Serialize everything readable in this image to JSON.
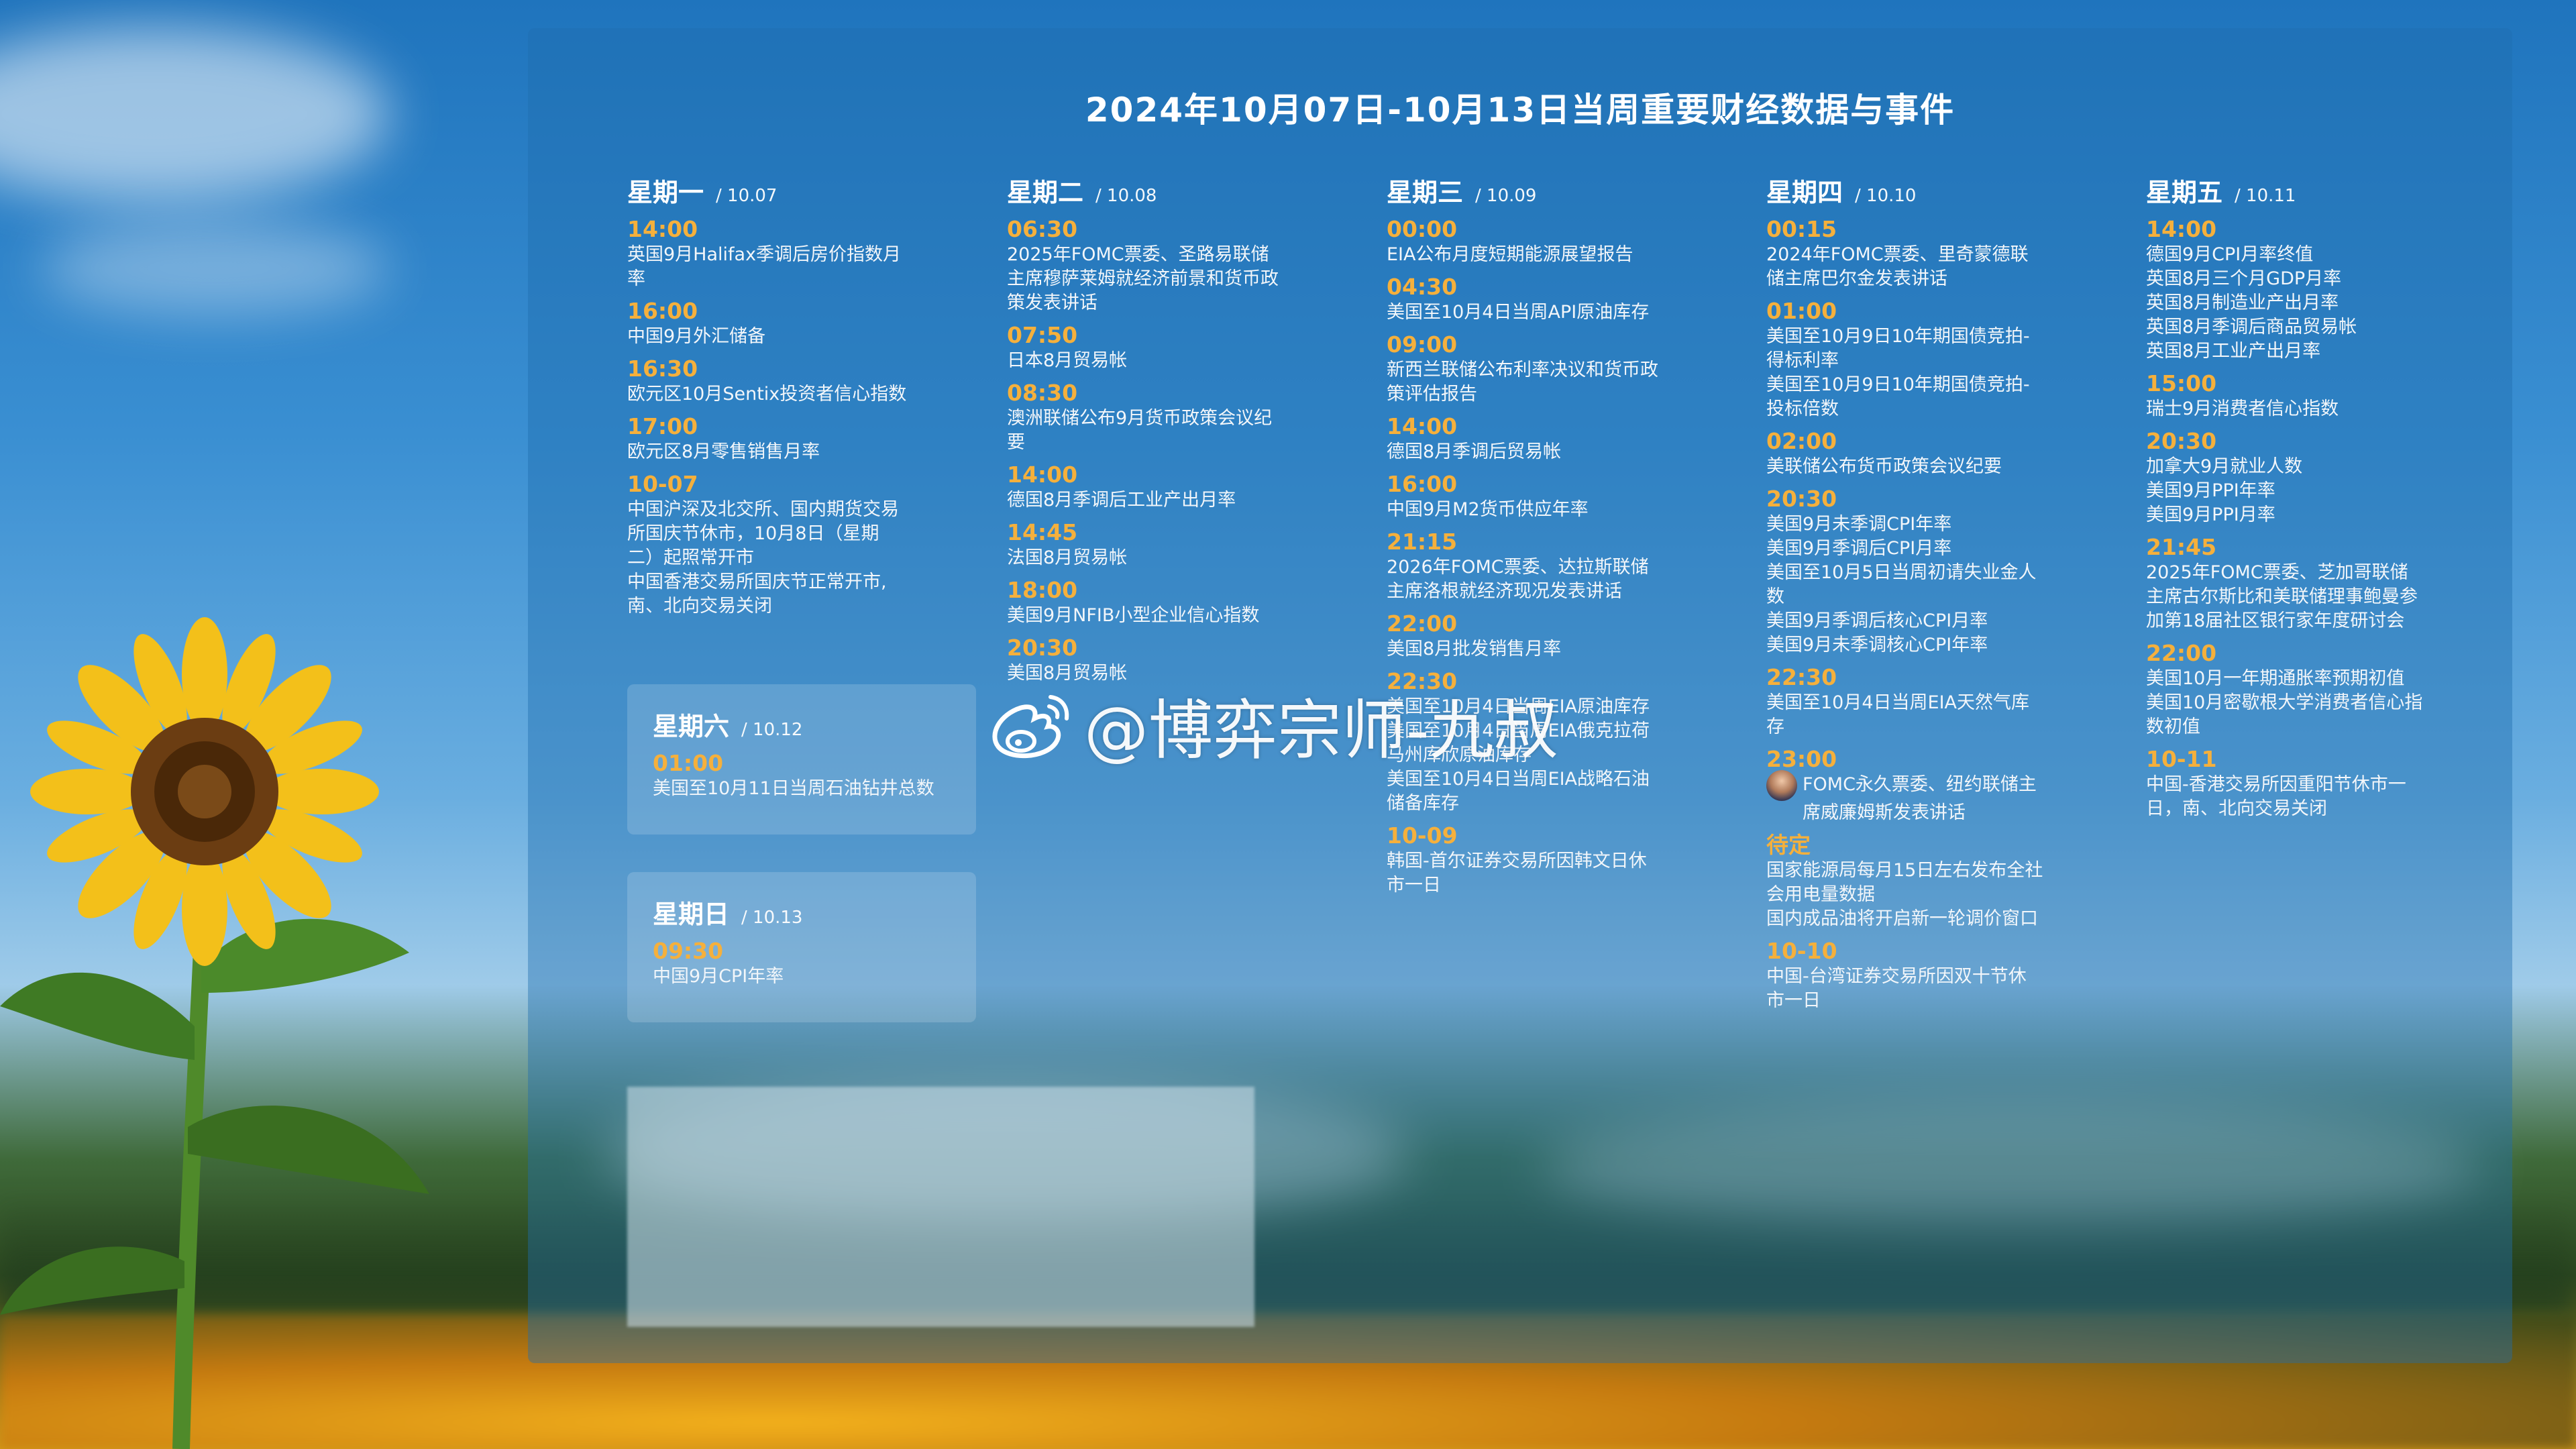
{
  "title": "2024年10月07日-10月13日当周重要财经数据与事件",
  "watermark": "@博弈宗师-九叔",
  "days": {
    "mon": {
      "name": "星期一",
      "date": "/ 10.07",
      "events": [
        {
          "time": "14:00",
          "lines": [
            "英国9月Halifax季调后房价指数月",
            "率"
          ]
        },
        {
          "time": "16:00",
          "lines": [
            "中国9月外汇储备"
          ]
        },
        {
          "time": "16:30",
          "lines": [
            "欧元区10月Sentix投资者信心指数"
          ]
        },
        {
          "time": "17:00",
          "lines": [
            "欧元区8月零售销售月率"
          ]
        },
        {
          "time": "10-07",
          "lines": [
            "中国沪深及北交所、国内期货交易",
            "所国庆节休市，10月8日（星期",
            "二）起照常开市",
            "中国香港交易所国庆节正常开市,",
            "南、北向交易关闭"
          ]
        }
      ]
    },
    "tue": {
      "name": "星期二",
      "date": "/ 10.08",
      "events": [
        {
          "time": "06:30",
          "lines": [
            "2025年FOMC票委、圣路易联储",
            "主席穆萨莱姆就经济前景和货币政",
            "策发表讲话"
          ]
        },
        {
          "time": "07:50",
          "lines": [
            "日本8月贸易帐"
          ]
        },
        {
          "time": "08:30",
          "lines": [
            "澳洲联储公布9月货币政策会议纪",
            "要"
          ]
        },
        {
          "time": "14:00",
          "lines": [
            "德国8月季调后工业产出月率"
          ]
        },
        {
          "time": "14:45",
          "lines": [
            "法国8月贸易帐"
          ]
        },
        {
          "time": "18:00",
          "lines": [
            "美国9月NFIB小型企业信心指数"
          ]
        },
        {
          "time": "20:30",
          "lines": [
            "美国8月贸易帐"
          ]
        }
      ]
    },
    "wed": {
      "name": "星期三",
      "date": "/ 10.09",
      "events": [
        {
          "time": "00:00",
          "lines": [
            "EIA公布月度短期能源展望报告"
          ]
        },
        {
          "time": "04:30",
          "lines": [
            "美国至10月4日当周API原油库存"
          ]
        },
        {
          "time": "09:00",
          "lines": [
            "新西兰联储公布利率决议和货币政",
            "策评估报告"
          ]
        },
        {
          "time": "14:00",
          "lines": [
            "德国8月季调后贸易帐"
          ]
        },
        {
          "time": "16:00",
          "lines": [
            "中国9月M2货币供应年率"
          ]
        },
        {
          "time": "21:15",
          "lines": [
            "2026年FOMC票委、达拉斯联储",
            "主席洛根就经济现况发表讲话"
          ]
        },
        {
          "time": "22:00",
          "lines": [
            "美国8月批发销售月率"
          ]
        },
        {
          "time": "22:30",
          "lines": [
            "美国至10月4日当周EIA原油库存",
            "美国至10月4日当周EIA俄克拉荷",
            "马州库欣原油库存",
            "美国至10月4日当周EIA战略石油",
            "储备库存"
          ]
        },
        {
          "time": "10-09",
          "lines": [
            "韩国-首尔证券交易所因韩文日休",
            "市一日"
          ]
        }
      ]
    },
    "thu": {
      "name": "星期四",
      "date": "/ 10.10",
      "events": [
        {
          "time": "00:15",
          "lines": [
            "2024年FOMC票委、里奇蒙德联",
            "储主席巴尔金发表讲话"
          ]
        },
        {
          "time": "01:00",
          "lines": [
            "美国至10月9日10年期国债竞拍-",
            "得标利率",
            "美国至10月9日10年期国债竞拍-",
            "投标倍数"
          ]
        },
        {
          "time": "02:00",
          "lines": [
            "美联储公布货币政策会议纪要"
          ]
        },
        {
          "time": "20:30",
          "lines": [
            "美国9月未季调CPI年率",
            "美国9月季调后CPI月率",
            "美国至10月5日当周初请失业金人",
            "数",
            "美国9月季调后核心CPI月率",
            "美国9月未季调核心CPI年率"
          ]
        },
        {
          "time": "22:30",
          "lines": [
            "美国至10月4日当周EIA天然气库",
            "存"
          ]
        },
        {
          "time": "23:00",
          "avatar": true,
          "lines": [
            "FOMC永久票委、纽约联储主",
            "席威廉姆斯发表讲话"
          ]
        },
        {
          "time": "待定",
          "lines": [
            "国家能源局每月15日左右发布全社",
            "会用电量数据",
            "国内成品油将开启新一轮调价窗口"
          ]
        },
        {
          "time": "10-10",
          "lines": [
            "中国-台湾证券交易所因双十节休",
            "市一日"
          ]
        }
      ]
    },
    "fri": {
      "name": "星期五",
      "date": "/ 10.11",
      "events": [
        {
          "time": "14:00",
          "lines": [
            "德国9月CPI月率终值",
            "英国8月三个月GDP月率",
            "英国8月制造业产出月率",
            "英国8月季调后商品贸易帐",
            "英国8月工业产出月率"
          ]
        },
        {
          "time": "15:00",
          "lines": [
            "瑞士9月消费者信心指数"
          ]
        },
        {
          "time": "20:30",
          "lines": [
            "加拿大9月就业人数",
            "美国9月PPI年率",
            "美国9月PPI月率"
          ]
        },
        {
          "time": "21:45",
          "lines": [
            "2025年FOMC票委、芝加哥联储",
            "主席古尔斯比和美联储理事鲍曼参",
            "加第18届社区银行家年度研讨会"
          ]
        },
        {
          "time": "22:00",
          "lines": [
            "美国10月一年期通胀率预期初值",
            "美国10月密歇根大学消费者信心指",
            "数初值"
          ]
        },
        {
          "time": "10-11",
          "lines": [
            "中国-香港交易所因重阳节休市一",
            "日，南、北向交易关闭"
          ]
        }
      ]
    },
    "sat": {
      "name": "星期六",
      "date": "/ 10.12",
      "events": [
        {
          "time": "01:00",
          "lines": [
            "美国至10月11日当周石油钻井总数"
          ]
        }
      ]
    },
    "sun": {
      "name": "星期日",
      "date": "/ 10.13",
      "events": [
        {
          "time": "09:30",
          "lines": [
            "中国9月CPI年率"
          ]
        }
      ]
    }
  },
  "colors": {
    "time": "#f5b03c",
    "panel": "rgba(30,110,175,0.42)"
  },
  "icons": {
    "watermark": "weibo-icon",
    "avatar": "person-avatar"
  }
}
